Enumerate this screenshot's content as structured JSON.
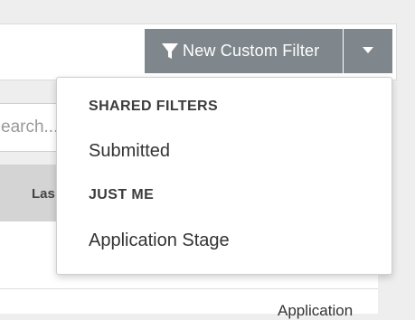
{
  "toolbar": {
    "new_filter_label": "New Custom Filter",
    "button_color": "#7f878c"
  },
  "search": {
    "placeholder_visible": "earch..."
  },
  "table": {
    "header_partial": "Las",
    "cell_partial": "Application"
  },
  "dropdown": {
    "sections": [
      {
        "title": "SHARED FILTERS",
        "items": [
          "Submitted"
        ]
      },
      {
        "title": "JUST ME",
        "items": [
          "Application Stage"
        ]
      }
    ]
  }
}
